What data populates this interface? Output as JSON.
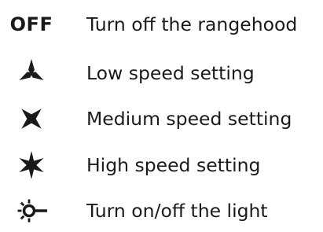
{
  "legend": {
    "off": {
      "symbol": "OFF",
      "description": "Turn off the rangehood"
    },
    "low": {
      "icon": "fan-low-icon",
      "description": "Low speed setting"
    },
    "medium": {
      "icon": "fan-medium-icon",
      "description": "Medium speed setting"
    },
    "high": {
      "icon": "fan-high-icon",
      "description": "High speed setting"
    },
    "light": {
      "icon": "light-icon",
      "description": "Turn on/off the light"
    }
  },
  "colors": {
    "ink": "#1a1a1a",
    "background": "#ffffff"
  }
}
